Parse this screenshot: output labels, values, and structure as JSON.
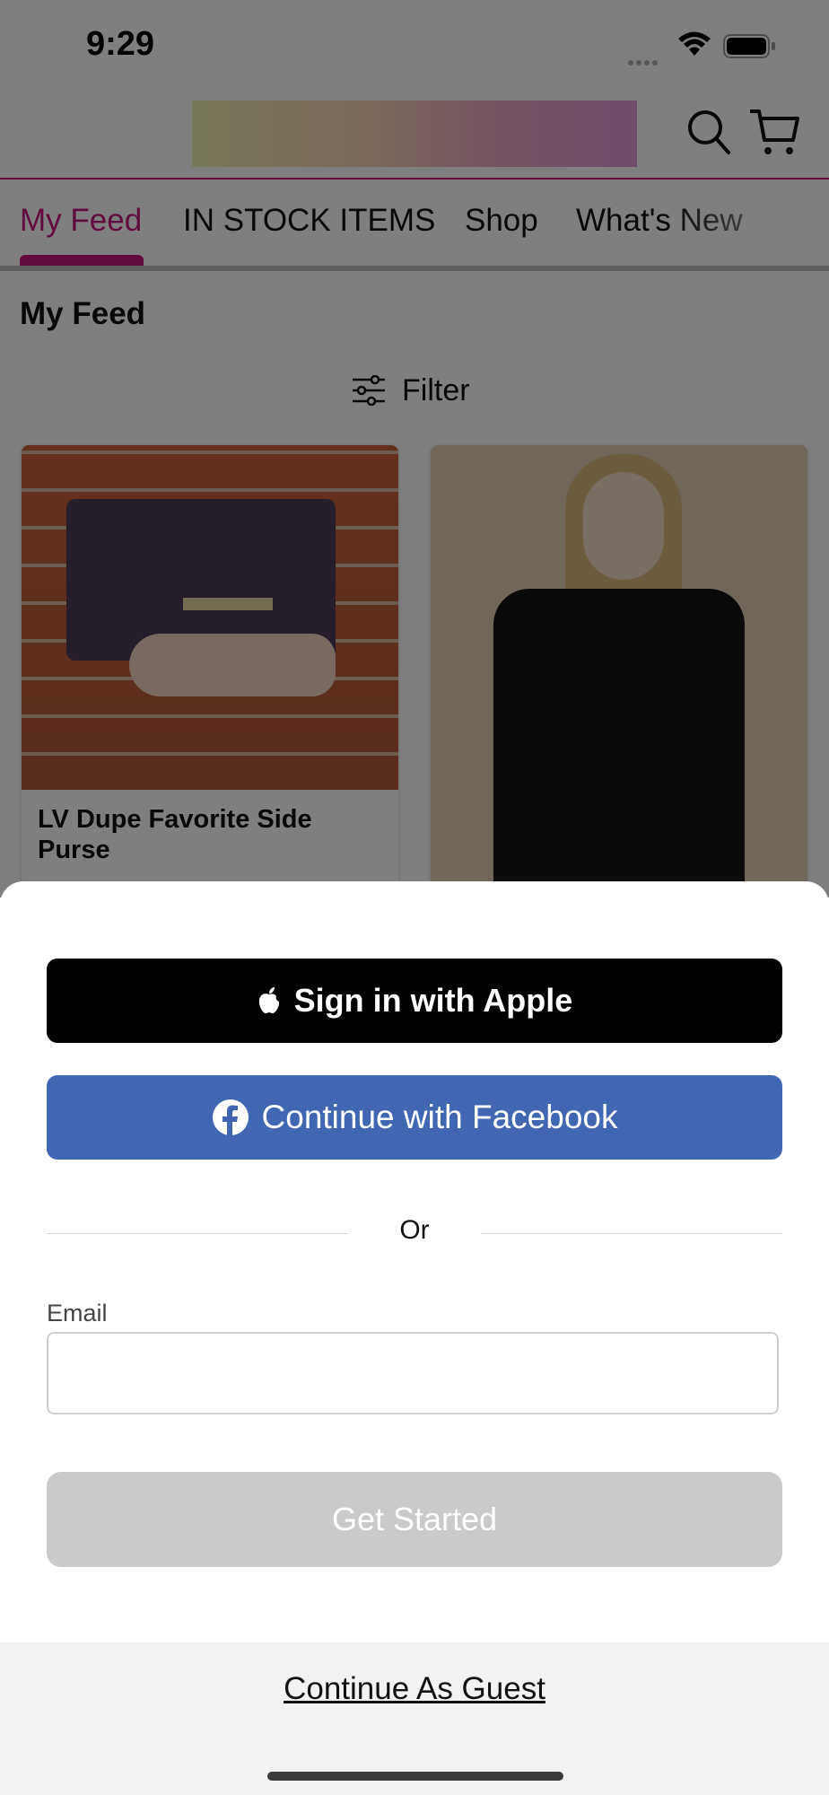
{
  "status_bar": {
    "time": "9:29"
  },
  "header": {
    "logo": "",
    "icons": [
      "search-icon",
      "cart-icon"
    ],
    "accent_color": "#d0197e"
  },
  "tabs": [
    {
      "label": "My Feed",
      "active": true
    },
    {
      "label": "IN STOCK ITEMS",
      "active": false
    },
    {
      "label": "Shop",
      "active": false
    },
    {
      "label": "What's New",
      "active": false
    }
  ],
  "feed": {
    "title": "My Feed",
    "filter_label": "Filter",
    "cards": [
      {
        "title": "LV Dupe Favorite Side Purse"
      },
      {
        "title": ""
      }
    ]
  },
  "login_sheet": {
    "apple_label": "Sign in with Apple",
    "facebook_label": "Continue with Facebook",
    "or_label": "Or",
    "email_label": "Email",
    "email_value": "",
    "email_placeholder": "",
    "get_started_label": "Get Started",
    "guest_label": "Continue As Guest"
  },
  "colors": {
    "apple_button": "#000000",
    "facebook_button": "#4267b2",
    "get_started_disabled": "#cacaca"
  }
}
